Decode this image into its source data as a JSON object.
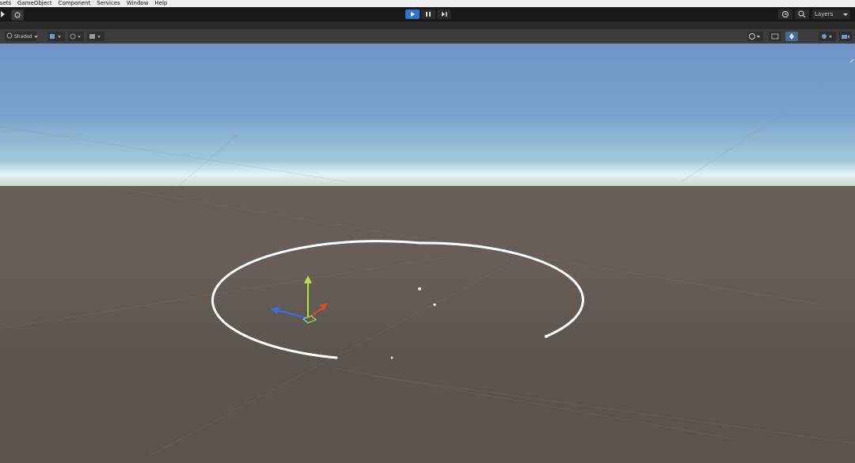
{
  "menubar": {
    "items": [
      "ssets",
      "GameObject",
      "Component",
      "Services",
      "Window",
      "Help"
    ]
  },
  "toolbar": {
    "play_icon": "play-icon",
    "pause_icon": "pause-icon",
    "step_icon": "step-icon",
    "layers_label": "Layers",
    "colors": {
      "play_active": "#2f74c8",
      "background": "#191919"
    }
  },
  "scene_toolbar": {
    "shading_label": "Shaded",
    "icons": [
      "draw-mode-icon",
      "toggle-2d-icon",
      "lighting-icon",
      "audio-icon",
      "gizmos-icon",
      "camera-icon"
    ]
  },
  "scene": {
    "sky_color_top": "#6f93c9",
    "horizon_color": "#e3f4f5",
    "ground_color": "#675e57",
    "gizmo_colors": {
      "x": "#d84b2b",
      "y": "#b7e33e",
      "z": "#3c6ee6"
    }
  }
}
